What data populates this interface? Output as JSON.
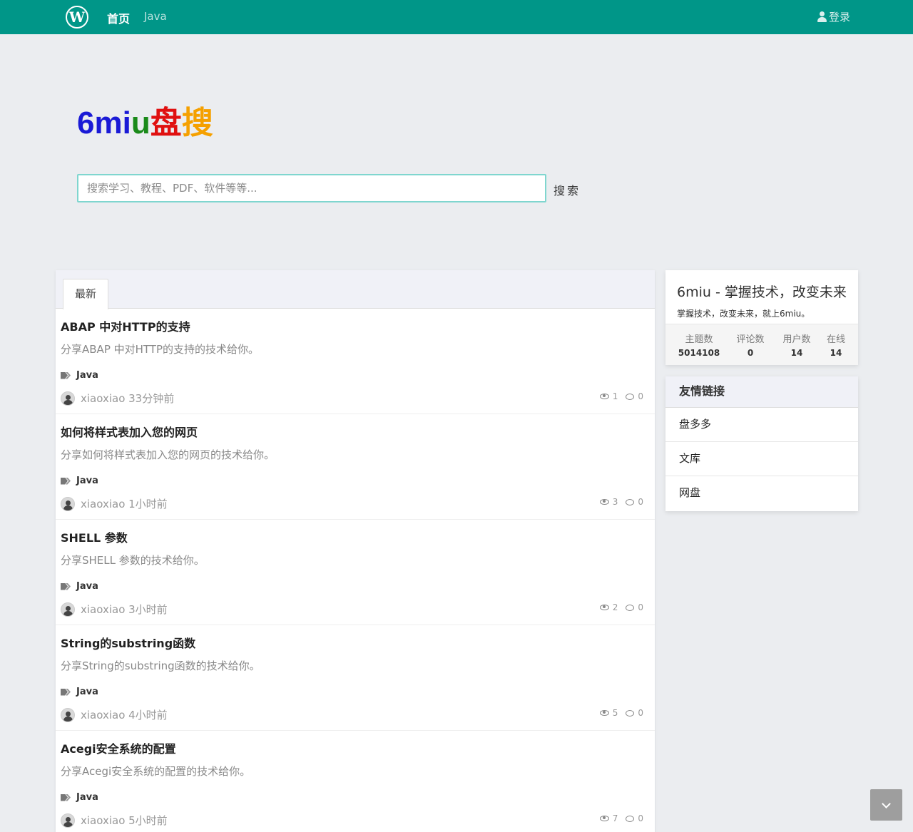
{
  "nav": {
    "logo_letter": "W",
    "home": "首页",
    "java": "Java",
    "login": "登录"
  },
  "brand": {
    "part1": "6mi",
    "part2": "u",
    "part3": "盘",
    "part4": "搜"
  },
  "search": {
    "placeholder": "搜索学习、教程、PDF、软件等等...",
    "button": "搜索"
  },
  "tabs": [
    "最新"
  ],
  "posts": [
    {
      "title": "ABAP 中对HTTP的支持",
      "desc": "分享ABAP 中对HTTP的支持的技术给你。",
      "tag": "Java",
      "author": "xiaoxiao 33分钟前",
      "views": "1",
      "comments": "0"
    },
    {
      "title": "如何将样式表加入您的网页",
      "desc": "分享如何将样式表加入您的网页的技术给你。",
      "tag": "Java",
      "author": "xiaoxiao 1小时前",
      "views": "3",
      "comments": "0"
    },
    {
      "title": "SHELL 参数",
      "desc": "分享SHELL 参数的技术给你。",
      "tag": "Java",
      "author": "xiaoxiao 3小时前",
      "views": "2",
      "comments": "0"
    },
    {
      "title": "String的substring函数",
      "desc": "分享String的substring函数的技术给你。",
      "tag": "Java",
      "author": "xiaoxiao 4小时前",
      "views": "5",
      "comments": "0"
    },
    {
      "title": "Acegi安全系统的配置",
      "desc": "分享Acegi安全系统的配置的技术给你。",
      "tag": "Java",
      "author": "xiaoxiao 5小时前",
      "views": "7",
      "comments": "0"
    }
  ],
  "sidebar": {
    "title": "6miu - 掌握技术，改变未来",
    "subtitle": "掌握技术，改变未来，就上6miu。",
    "stats": [
      {
        "label": "主题数",
        "value": "5014108"
      },
      {
        "label": "评论数",
        "value": "0"
      },
      {
        "label": "用户数",
        "value": "14"
      },
      {
        "label": "在线",
        "value": "14"
      }
    ]
  },
  "links": {
    "heading": "友情链接",
    "items": [
      "盘多多",
      "文库",
      "网盘"
    ]
  }
}
